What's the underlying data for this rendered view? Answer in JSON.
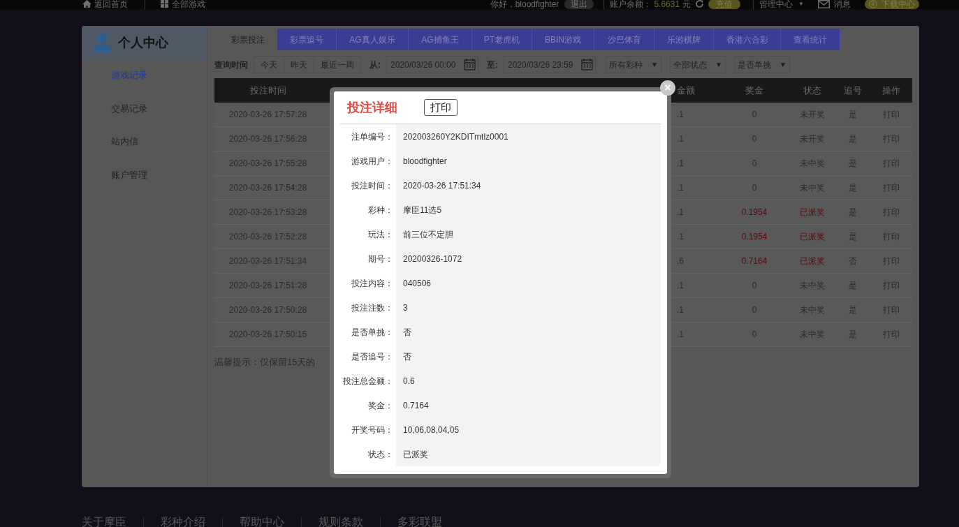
{
  "top_bar": {
    "left_links": [
      {
        "kind": "home",
        "label": "返回首页"
      },
      {
        "kind": "grid",
        "label": "全部游戏"
      }
    ],
    "greeting": "你好，bloodfighter",
    "logout": "退出",
    "balance_label": "账户余额：",
    "balance_value": "5.6631",
    "balance_unit": "元",
    "recharge": "充值",
    "menu": "管理中心",
    "menu_caret": "▼",
    "messages": "消息",
    "download": "下载中心"
  },
  "sidebar": {
    "title": "个人中心",
    "items": [
      {
        "label": "游戏记录",
        "selected": true
      },
      {
        "label": "交易记录",
        "selected": false
      },
      {
        "label": "站内信",
        "selected": false
      },
      {
        "label": "账户管理",
        "selected": false
      }
    ]
  },
  "tabs": [
    {
      "label": "彩票投注",
      "selected": true
    },
    {
      "label": "彩票追号",
      "selected": false
    },
    {
      "label": "AG真人娱乐",
      "selected": false
    },
    {
      "label": "AG捕鱼王",
      "selected": false
    },
    {
      "label": "PT老虎机",
      "selected": false
    },
    {
      "label": "BBIN游戏",
      "selected": false
    },
    {
      "label": "沙巴体育",
      "selected": false
    },
    {
      "label": "乐游棋牌",
      "selected": false
    },
    {
      "label": "香港六合彩",
      "selected": false
    },
    {
      "label": "查看统计",
      "selected": false
    }
  ],
  "filters": {
    "label": "查询时间",
    "quick": [
      "今天",
      "昨天",
      "最近一周"
    ],
    "from_label": "从:",
    "from_value": "2020/03/26 00:00",
    "to_label": "至:",
    "to_value": "2020/03/26 23:59",
    "selects": [
      {
        "label": "所有彩种",
        "caret": "▼"
      },
      {
        "label": "全部状态",
        "caret": "▼"
      },
      {
        "label": "是否单挑",
        "caret": "▼"
      }
    ]
  },
  "table": {
    "columns": [
      "投注时间",
      "金额",
      "奖金",
      "状态",
      "追号",
      "操作"
    ],
    "rows": [
      {
        "time": "2020-03-26 17:57:28",
        "amount": ".1",
        "prize": "0",
        "status": "未开奖",
        "chase": "是",
        "action": "打印",
        "won": false
      },
      {
        "time": "2020-03-26 17:56:28",
        "amount": ".1",
        "prize": "0",
        "status": "未开奖",
        "chase": "是",
        "action": "打印",
        "won": false
      },
      {
        "time": "2020-03-26 17:55:28",
        "amount": ".1",
        "prize": "0",
        "status": "未中奖",
        "chase": "是",
        "action": "打印",
        "won": false
      },
      {
        "time": "2020-03-26 17:54:28",
        "amount": ".1",
        "prize": "0",
        "status": "未中奖",
        "chase": "是",
        "action": "打印",
        "won": false
      },
      {
        "time": "2020-03-26 17:53:28",
        "amount": ".1",
        "prize": "0.1954",
        "status": "已派奖",
        "chase": "是",
        "action": "打印",
        "won": true
      },
      {
        "time": "2020-03-26 17:52:28",
        "amount": ".1",
        "prize": "0.1954",
        "status": "已派奖",
        "chase": "是",
        "action": "打印",
        "won": true
      },
      {
        "time": "2020-03-26 17:51:34",
        "amount": ".6",
        "prize": "0.7164",
        "status": "已派奖",
        "chase": "否",
        "action": "打印",
        "won": true
      },
      {
        "time": "2020-03-26 17:51:28",
        "amount": ".1",
        "prize": "0",
        "status": "未中奖",
        "chase": "是",
        "action": "打印",
        "won": false
      },
      {
        "time": "2020-03-26 17:50:28",
        "amount": ".1",
        "prize": "0",
        "status": "未中奖",
        "chase": "是",
        "action": "打印",
        "won": false
      },
      {
        "time": "2020-03-26 17:50:15",
        "amount": ".1",
        "prize": "0",
        "status": "未中奖",
        "chase": "是",
        "action": "打印",
        "won": false
      }
    ]
  },
  "tip": "温馨提示：仅保留15天的",
  "modal": {
    "title": "投注详细",
    "print": "打印",
    "close": "×",
    "fields": [
      {
        "label": "注单编号：",
        "value": "202003260Y2KDITmtlz0001"
      },
      {
        "label": "游戏用户：",
        "value": "bloodfighter"
      },
      {
        "label": "投注时间：",
        "value": "2020-03-26 17:51:34"
      },
      {
        "label": "彩种：",
        "value": "摩臣11选5"
      },
      {
        "label": "玩法：",
        "value": "前三位不定胆"
      },
      {
        "label": "期号：",
        "value": "20200326-1072"
      },
      {
        "label": "投注内容：",
        "value": "040506"
      },
      {
        "label": "投注注数：",
        "value": "3"
      },
      {
        "label": "是否单挑：",
        "value": "否"
      },
      {
        "label": "是否追号：",
        "value": "否"
      },
      {
        "label": "投注总金额：",
        "value": "0.6"
      },
      {
        "label": "奖金：",
        "value": "0.7164"
      },
      {
        "label": "开奖号码：",
        "value": "10,06,08,04,05"
      },
      {
        "label": "状态：",
        "value": "已派奖"
      }
    ]
  },
  "footer_links": [
    "关于摩臣",
    "彩种介绍",
    "帮助中心",
    "规则条款",
    "多彩联盟"
  ]
}
